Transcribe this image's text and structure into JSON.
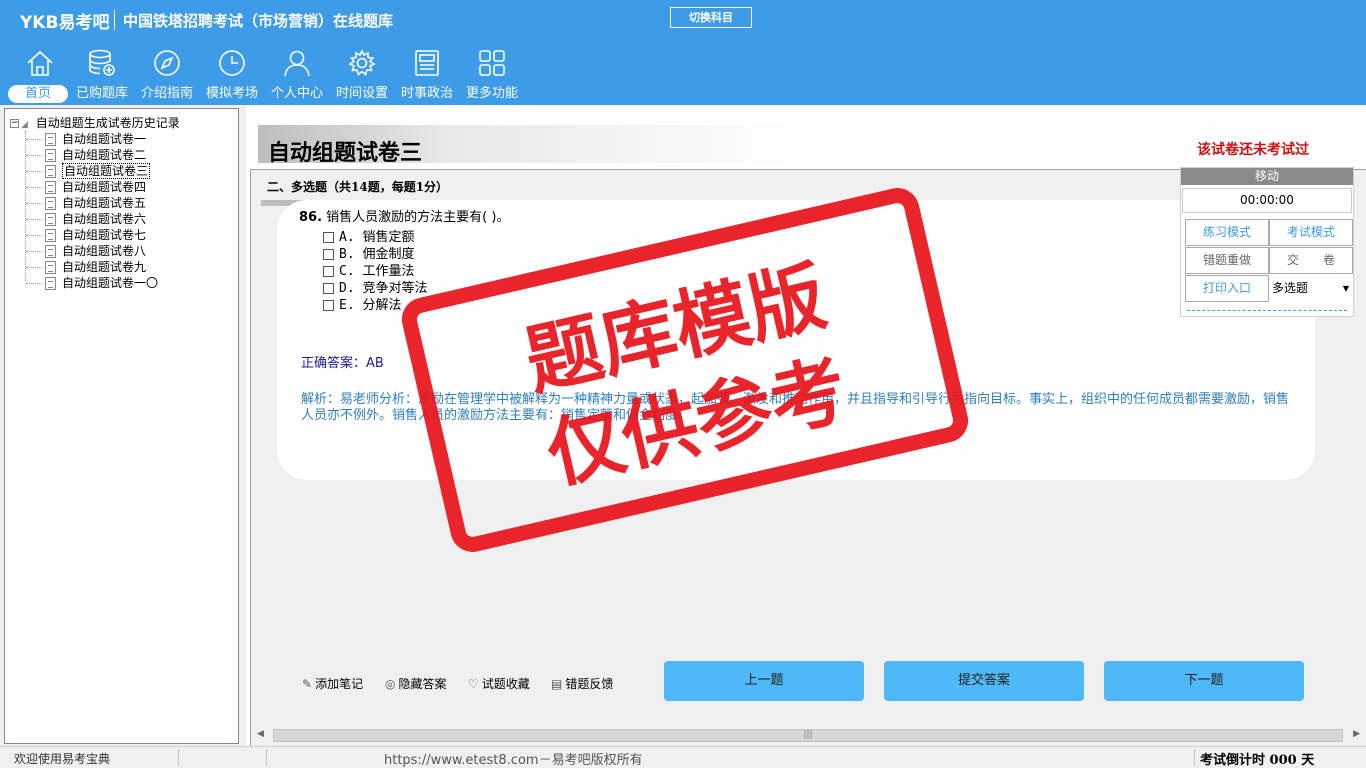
{
  "header": {
    "brand": "YKB易考吧",
    "title": "中国铁塔招聘考试（市场营销）在线题库",
    "switch_subject": "切换科目",
    "nav": [
      {
        "label": "首页",
        "icon": "home-icon"
      },
      {
        "label": "已购题库",
        "icon": "database-icon"
      },
      {
        "label": "介绍指南",
        "icon": "compass-icon"
      },
      {
        "label": "模拟考场",
        "icon": "clock-icon"
      },
      {
        "label": "个人中心",
        "icon": "user-icon"
      },
      {
        "label": "时间设置",
        "icon": "gear-icon"
      },
      {
        "label": "时事政治",
        "icon": "news-icon"
      },
      {
        "label": "更多功能",
        "icon": "grid-icon"
      }
    ]
  },
  "sidebar": {
    "root": "自动组题生成试卷历史记录",
    "items": [
      "自动组题试卷一",
      "自动组题试卷二",
      "自动组题试卷三",
      "自动组题试卷四",
      "自动组题试卷五",
      "自动组题试卷六",
      "自动组题试卷七",
      "自动组题试卷八",
      "自动组题试卷九",
      "自动组题试卷一〇"
    ],
    "selected_index": 2
  },
  "main": {
    "paper_title": "自动组题试卷三",
    "status": "该试卷还未考试过",
    "section_header": "二、多选题（共14题，每题1分）",
    "question": {
      "number": "86.",
      "stem": "销售人员激励的方法主要有( )。",
      "options": [
        "A. 销售定额",
        "B. 佣金制度",
        "C. 工作量法",
        "D. 竞争对等法",
        "E. 分解法"
      ],
      "answer": "正确答案：AB",
      "analysis": "解析：易老师分析：激励在管理学中被解释为一种精神力量或状态，起加强、激发和推动作用，并且指导和引导行为指向目标。事实上，组织中的任何成员都需要激励，销售人员亦不例外。销售人员的激励方法主要有：销售定额和佣金制度。"
    },
    "tools": [
      {
        "label": "添加笔记",
        "icon": "pencil-icon"
      },
      {
        "label": "隐藏答案",
        "icon": "eye-icon"
      },
      {
        "label": "试题收藏",
        "icon": "heart-icon"
      },
      {
        "label": "错题反馈",
        "icon": "feedback-icon"
      }
    ],
    "buttons": {
      "prev": "上一题",
      "submit": "提交答案",
      "next": "下一题"
    }
  },
  "right_panel": {
    "move": "移动",
    "timer": "00:00:00",
    "practice_mode": "练习模式",
    "exam_mode": "考试模式",
    "redo_wrong": "错题重做",
    "hand_in": "交　　卷",
    "print_entry": "打印入口",
    "question_type": "多选题"
  },
  "statusbar": {
    "welcome": "欢迎使用易考宝典",
    "copyright": "https://www.etest8.com－易考吧版权所有",
    "countdown": "考试倒计时 000 天"
  },
  "watermark": {
    "line1": "题库模版",
    "line2": "仅供参考"
  },
  "colors": {
    "header_blue": "#3d9be8",
    "button_blue": "#4fb9f8",
    "stamp_red": "#e8141b",
    "status_red": "#cc1111"
  }
}
